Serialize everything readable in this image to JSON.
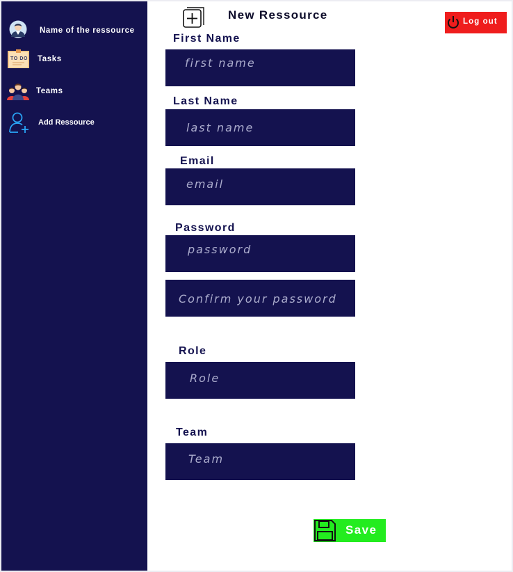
{
  "sidebar": {
    "items": [
      {
        "label": "Name of the ressource",
        "icon": "user-avatar-icon"
      },
      {
        "label": "Tasks",
        "icon": "todo-note-icon"
      },
      {
        "label": "Teams",
        "icon": "team-people-icon"
      },
      {
        "label": "Add Ressource",
        "icon": "add-user-icon"
      }
    ]
  },
  "header": {
    "title": "New Ressource",
    "icon": "add-document-icon",
    "logout_label": "Log out",
    "logout_icon": "power-icon"
  },
  "form": {
    "first_name": {
      "label": "First Name",
      "placeholder": "first name"
    },
    "last_name": {
      "label": "Last Name",
      "placeholder": "last name"
    },
    "email": {
      "label": "Email",
      "placeholder": "email"
    },
    "password": {
      "label": "Password",
      "placeholder": "password",
      "confirm_placeholder": "Confirm your password"
    },
    "role": {
      "label": "Role",
      "placeholder": "Role"
    },
    "team": {
      "label": "Team",
      "placeholder": "Team"
    }
  },
  "save": {
    "label": "Save",
    "icon": "floppy-disk-icon"
  },
  "colors": {
    "sidebar_bg": "#14124f",
    "input_bg": "#14124f",
    "logout_bg": "#ef1d1d",
    "save_bg": "#23ec1f"
  }
}
